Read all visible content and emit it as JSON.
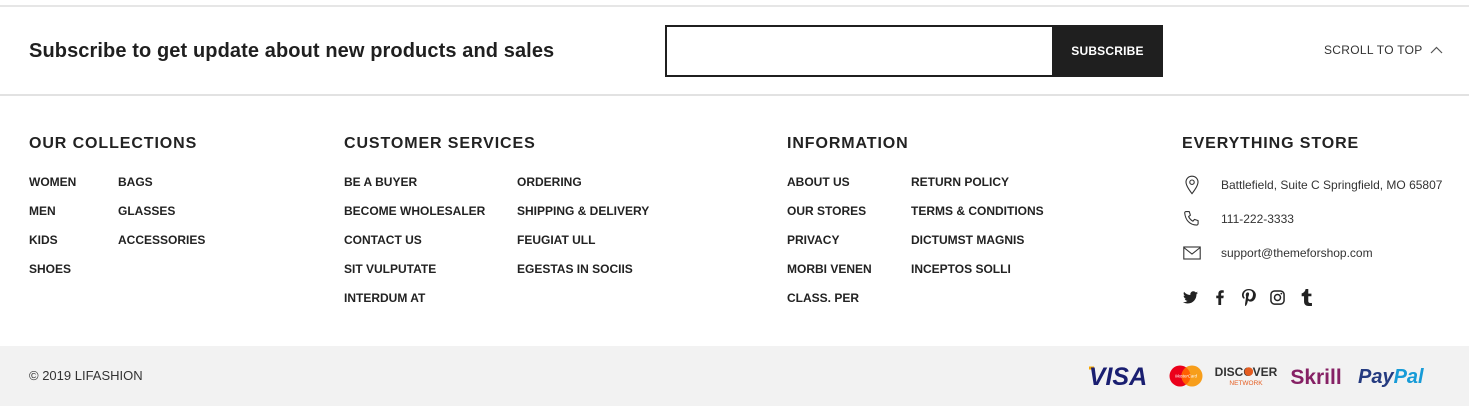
{
  "subscribe": {
    "title": "Subscribe to get update about new products and sales",
    "email_value": "",
    "email_placeholder": "",
    "button_label": "SUBSCRIBE",
    "scroll_label": "SCROLL TO TOP"
  },
  "collections": {
    "title": "OUR COLLECTIONS",
    "col1": [
      "WOMEN",
      "MEN",
      "KIDS",
      "SHOES"
    ],
    "col2": [
      "BAGS",
      "GLASSES",
      "ACCESSORIES"
    ]
  },
  "customer_services": {
    "title": "CUSTOMER SERVICES",
    "col1": [
      "BE A BUYER",
      "BECOME WHOLESALER",
      "CONTACT US",
      "SIT VULPUTATE",
      "INTERDUM AT"
    ],
    "col2": [
      "ORDERING",
      "SHIPPING & DELIVERY",
      "FEUGIAT ULL",
      "EGESTAS IN SOCIIS"
    ]
  },
  "information": {
    "title": "INFORMATION",
    "col1": [
      "ABOUT US",
      "OUR STORES",
      "PRIVACY",
      "MORBI VENEN",
      "CLASS. PER"
    ],
    "col2": [
      "RETURN POLICY",
      "TERMS & CONDITIONS",
      "DICTUMST MAGNIS",
      "INCEPTOS SOLLI"
    ]
  },
  "store": {
    "title": "EVERYTHING STORE",
    "address": "Battlefield, Suite C Springfield, MO 65807",
    "phone": "111-222-3333",
    "email": "support@themeforshop.com",
    "social_icons": [
      "twitter-icon",
      "facebook-icon",
      "pinterest-icon",
      "instagram-icon",
      "tumblr-icon"
    ]
  },
  "footer": {
    "copyright": "© 2019 LIFASHION",
    "payments": {
      "visa": "VISA",
      "mastercard": "MasterCard",
      "discover": "DISCOVER",
      "discover_sub": "NETWORK",
      "skrill": "Skrill",
      "paypal": "PayPal"
    }
  },
  "colors": {
    "dark": "#1f1f1f",
    "footer_bg": "#f2f2f2",
    "visa_blue": "#1a1f71",
    "visa_gold": "#f7a600",
    "mastercard_red": "#eb001b",
    "mastercard_orange": "#f79e1b",
    "discover_orange": "#e55c20",
    "skrill_purple": "#862165",
    "paypal_dark": "#253b80",
    "paypal_light": "#179bd7"
  }
}
